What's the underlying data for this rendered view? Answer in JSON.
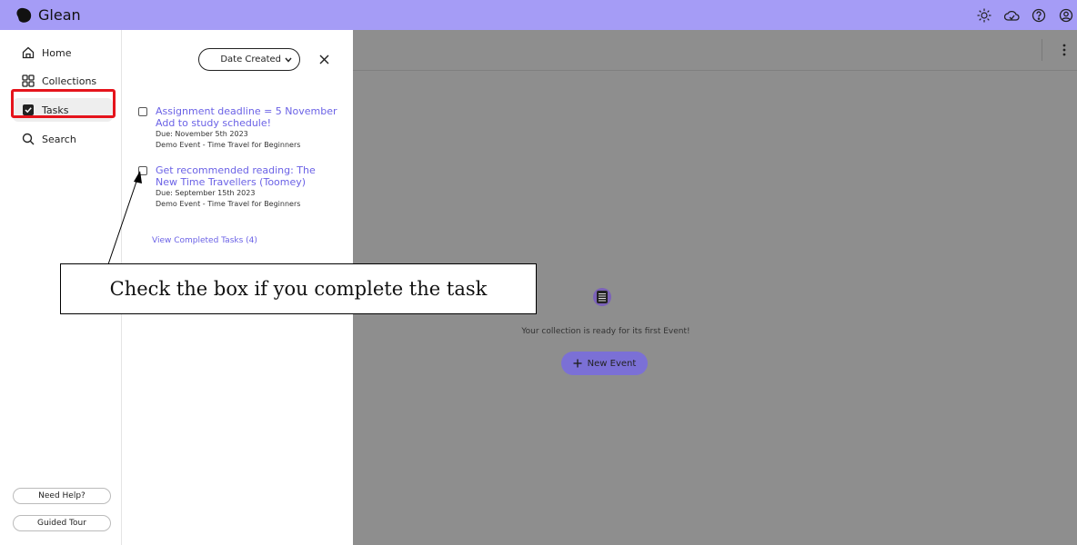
{
  "app": {
    "name": "Glean"
  },
  "colors": {
    "topbar": "#a59cf6",
    "accent": "#6b62e6",
    "highlight": "#e5141c",
    "overlay": "#8e8e8e"
  },
  "topbar": {
    "icons": [
      "sun-icon",
      "cloud-icon",
      "help-icon",
      "account-icon"
    ]
  },
  "sidebar": {
    "items": [
      {
        "label": "Home",
        "icon": "home-icon"
      },
      {
        "label": "Collections",
        "icon": "grid-icon"
      },
      {
        "label": "Tasks",
        "icon": "checkbox-icon",
        "active": true
      },
      {
        "label": "Search",
        "icon": "search-icon"
      }
    ],
    "help_label": "Need Help?",
    "tour_label": "Guided Tour"
  },
  "tasks_panel": {
    "sort_label": "Date Created",
    "tasks": [
      {
        "title": "Assignment deadline = 5 November Add to study schedule!",
        "due": "Due: November 5th 2023",
        "event": "Demo Event - Time Travel for Beginners"
      },
      {
        "title": "Get recommended reading: The New Time Travellers (Toomey)",
        "due": "Due: September 15th 2023",
        "event": "Demo Event - Time Travel for Beginners"
      }
    ],
    "view_completed": "View Completed Tasks (4)"
  },
  "main": {
    "empty_message": "Your collection is ready for its first Event!",
    "new_event_label": "New Event"
  },
  "annotation": {
    "text": "Check the box if you complete the task"
  }
}
